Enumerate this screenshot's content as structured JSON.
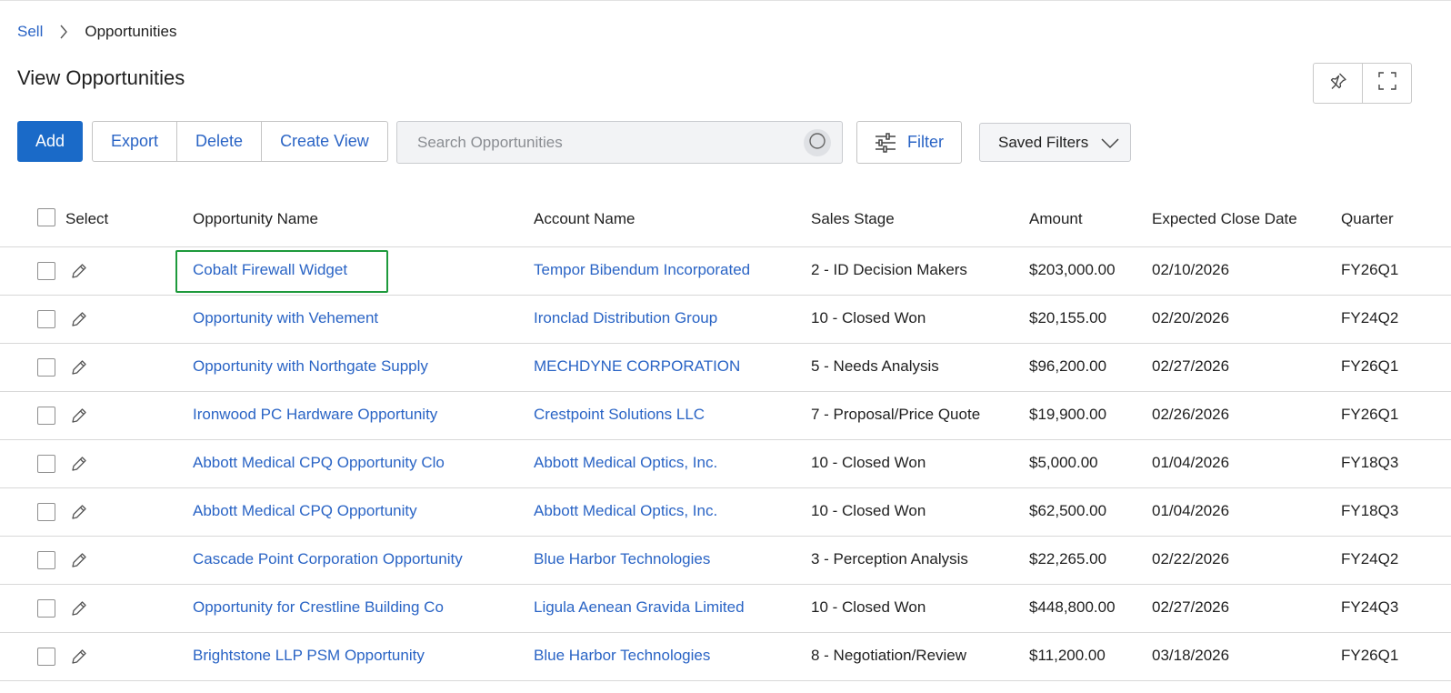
{
  "breadcrumb": {
    "parent": "Sell",
    "current": "Opportunities"
  },
  "page_title": "View Opportunities",
  "toolbar": {
    "add_label": "Add",
    "export_label": "Export",
    "delete_label": "Delete",
    "create_view_label": "Create View",
    "filter_label": "Filter",
    "saved_filters_label": "Saved Filters"
  },
  "search": {
    "placeholder": "Search Opportunities",
    "value": ""
  },
  "icons": {
    "pin": "pin-icon",
    "fullscreen": "fullscreen-icon",
    "search": "search-icon",
    "filter": "sliders-icon",
    "chevron": "chevron-down-icon",
    "edit": "pencil-icon",
    "breadcrumb_separator": "chevron-right-icon"
  },
  "colors": {
    "primary": "#1a6ac8",
    "link": "#2a64c5",
    "highlight": "#1e9a3c"
  },
  "table": {
    "columns": [
      "Select",
      "Opportunity Name",
      "Account Name",
      "Sales Stage",
      "Amount",
      "Expected Close Date",
      "Quarter"
    ],
    "rows": [
      {
        "name": "Cobalt Firewall Widget",
        "account": "Tempor Bibendum Incorporated",
        "stage": "2 - ID Decision Makers",
        "amount": "$203,000.00",
        "close_date": "02/10/2026",
        "quarter": "FY26Q1"
      },
      {
        "name": "Opportunity with Vehement",
        "account": "Ironclad Distribution Group",
        "stage": "10 - Closed Won",
        "amount": "$20,155.00",
        "close_date": "02/20/2026",
        "quarter": "FY24Q2"
      },
      {
        "name": "Opportunity with Northgate Supply",
        "account": "MECHDYNE CORPORATION",
        "stage": "5 - Needs Analysis",
        "amount": "$96,200.00",
        "close_date": "02/27/2026",
        "quarter": "FY26Q1"
      },
      {
        "name": "Ironwood PC Hardware Opportunity",
        "account": "Crestpoint Solutions LLC",
        "stage": "7 - Proposal/Price Quote",
        "amount": "$19,900.00",
        "close_date": "02/26/2026",
        "quarter": "FY26Q1"
      },
      {
        "name": "Abbott Medical CPQ Opportunity Clo",
        "account": "Abbott Medical Optics, Inc.",
        "stage": "10 - Closed Won",
        "amount": "$5,000.00",
        "close_date": "01/04/2026",
        "quarter": "FY18Q3"
      },
      {
        "name": "Abbott Medical CPQ Opportunity",
        "account": "Abbott Medical Optics, Inc.",
        "stage": "10 - Closed Won",
        "amount": "$62,500.00",
        "close_date": "01/04/2026",
        "quarter": "FY18Q3"
      },
      {
        "name": "Cascade Point Corporation Opportunity",
        "account": "Blue Harbor Technologies",
        "stage": "3 - Perception Analysis",
        "amount": "$22,265.00",
        "close_date": "02/22/2026",
        "quarter": "FY24Q2"
      },
      {
        "name": "Opportunity for Crestline Building Co",
        "account": "Ligula Aenean Gravida Limited",
        "stage": "10 - Closed Won",
        "amount": "$448,800.00",
        "close_date": "02/27/2026",
        "quarter": "FY24Q3"
      },
      {
        "name": "Brightstone LLP PSM Opportunity",
        "account": "Blue Harbor Technologies",
        "stage": "8 - Negotiation/Review",
        "amount": "$11,200.00",
        "close_date": "03/18/2026",
        "quarter": "FY26Q1"
      }
    ]
  }
}
